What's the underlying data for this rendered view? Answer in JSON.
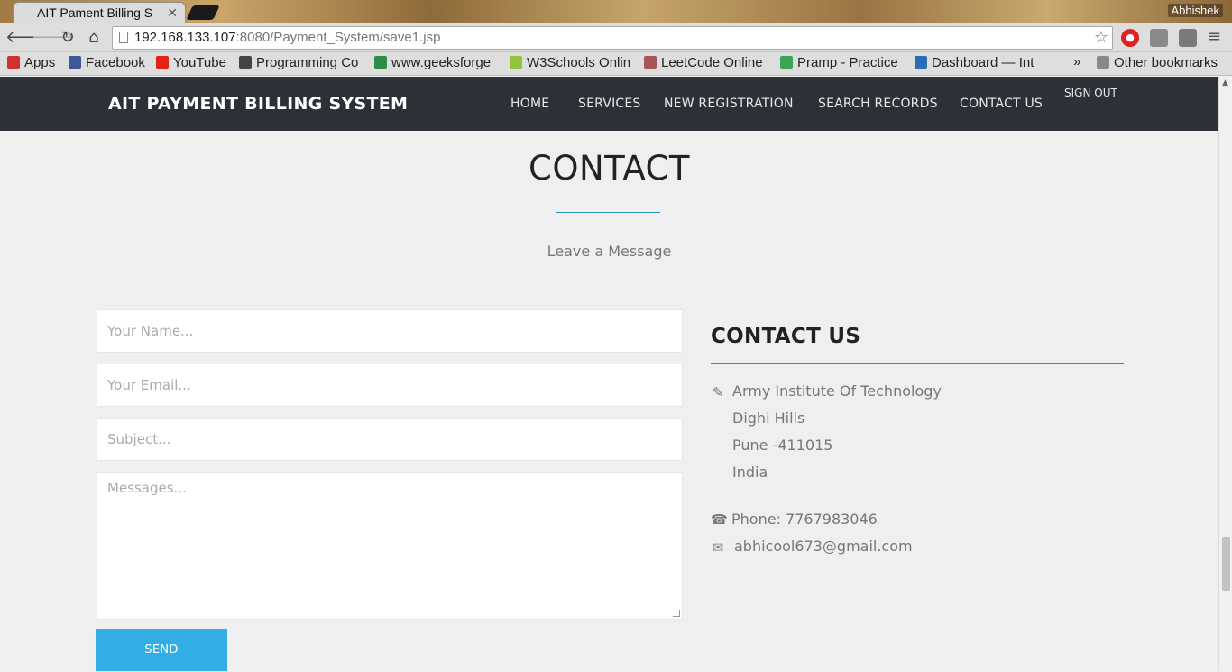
{
  "browser": {
    "tab_title": "AIT Pament Billing S",
    "profile_name": "Abhishek",
    "url_host": "192.168.133.107",
    "url_rest": ":8080/Payment_System/save1.jsp",
    "bookmarks": [
      {
        "label": "Apps",
        "icon": "apps-grid-icon",
        "color": "#d03030"
      },
      {
        "label": "Facebook",
        "icon": "facebook-icon",
        "color": "#3b5998"
      },
      {
        "label": "YouTube",
        "icon": "youtube-icon",
        "color": "#e62117"
      },
      {
        "label": "Programming Co",
        "icon": "cc-icon",
        "color": "#444444"
      },
      {
        "label": "www.geeksforge",
        "icon": "geeksforgeeks-icon",
        "color": "#2f8d46"
      },
      {
        "label": "W3Schools Onlin",
        "icon": "w3schools-icon",
        "color": "#8fc43c"
      },
      {
        "label": "LeetCode Online",
        "icon": "leetcode-icon",
        "color": "#aa5555"
      },
      {
        "label": "Pramp - Practice",
        "icon": "pramp-icon",
        "color": "#3aa655"
      },
      {
        "label": "Dashboard — Int",
        "icon": "interviewbit-icon",
        "color": "#2d6db5"
      }
    ],
    "overflow_label": "»",
    "other_bookmarks": "Other bookmarks"
  },
  "site": {
    "brand": "AIT PAYMENT BILLING SYSTEM",
    "menu": [
      "HOME",
      "SERVICES",
      "NEW REGISTRATION",
      "SEARCH RECORDS",
      "CONTACT US"
    ],
    "signout": "SIGN OUT"
  },
  "contact": {
    "title": "CONTACT",
    "subtitle": "Leave a Message",
    "form": {
      "name_placeholder": "Your Name...",
      "email_placeholder": "Your Email...",
      "subject_placeholder": "Subject...",
      "message_placeholder": "Messages...",
      "send_label": "SEND"
    },
    "info": {
      "heading": "CONTACT US",
      "address": [
        "Army Institute Of Technology",
        "Dighi Hills",
        "Pune -411015",
        "India"
      ],
      "phone": "Phone: 7767983046",
      "email": "abhicool673@gmail.com"
    }
  },
  "colors": {
    "navbar": "#2b3136",
    "accent": "#33aee4",
    "rule": "#2a8bbf"
  }
}
